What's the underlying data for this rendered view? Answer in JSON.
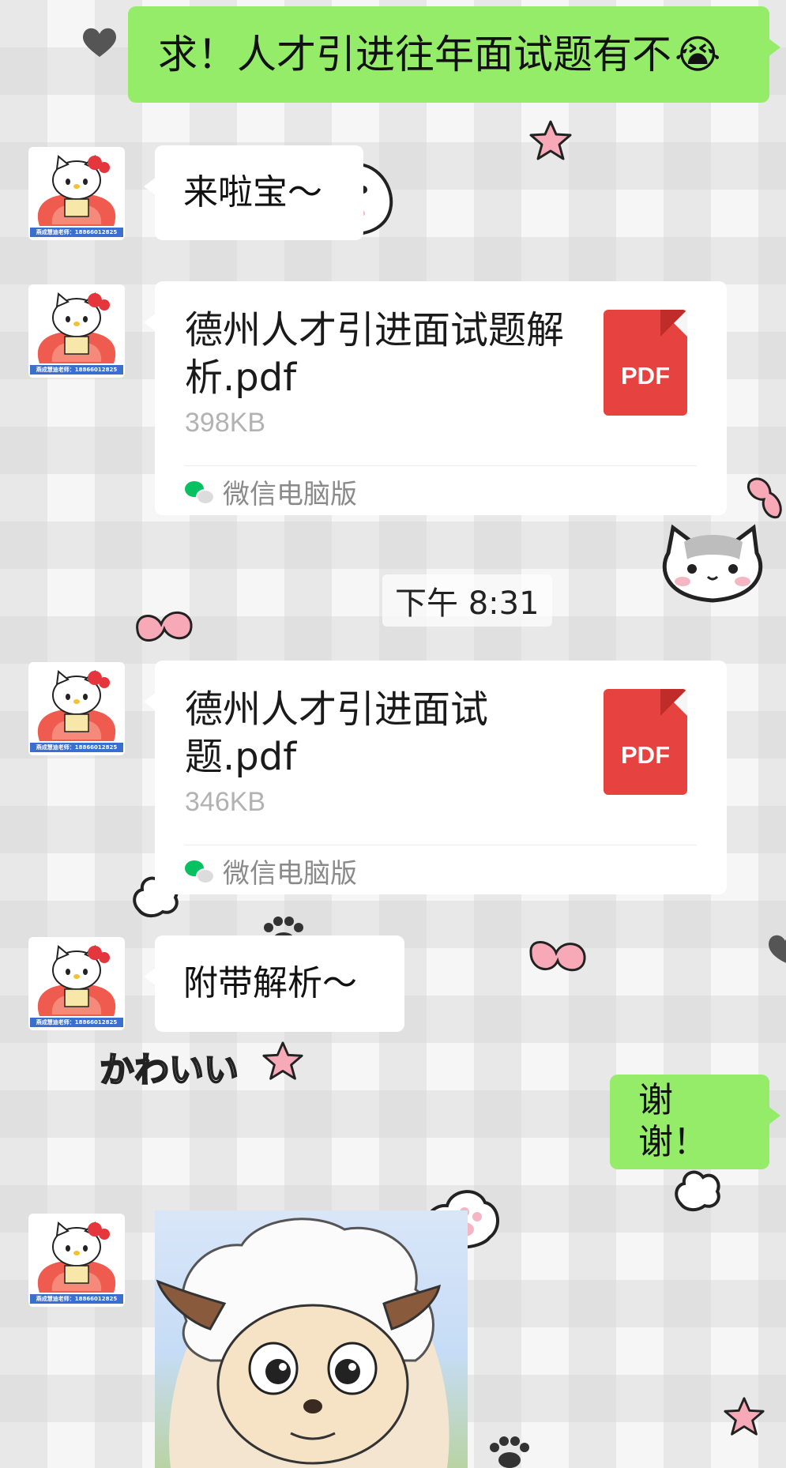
{
  "messages": {
    "m1": {
      "sender": "me",
      "text": "求！人才引进往年面试题有不",
      "emoji": "😭"
    },
    "m2": {
      "sender": "other",
      "text": "来啦宝～"
    },
    "m3": {
      "sender": "other",
      "file_name": "德州人才引进面试题解析.pdf",
      "file_size": "398KB",
      "file_type": "PDF",
      "source": "微信电脑版"
    },
    "time_divider": "下午 8:31",
    "m4": {
      "sender": "other",
      "file_name": "德州人才引进面试题.pdf",
      "file_size": "346KB",
      "file_type": "PDF",
      "source": "微信电脑版"
    },
    "m5": {
      "sender": "other",
      "text": "附带解析～"
    },
    "m6": {
      "sender": "me",
      "text": "谢谢！"
    },
    "m7": {
      "sender": "other",
      "type": "sticker"
    }
  },
  "avatar": {
    "caption": "燕成慧迪老师：18866012825"
  },
  "decorations": {
    "kawaii_text": "かわいい"
  },
  "colors": {
    "my_bubble": "#95ec69",
    "other_bubble": "#ffffff",
    "pdf_red": "#e64340",
    "wechat_green": "#07c160"
  },
  "icons": {
    "file": "pdf-file-icon",
    "source": "wechat-logo-icon"
  }
}
